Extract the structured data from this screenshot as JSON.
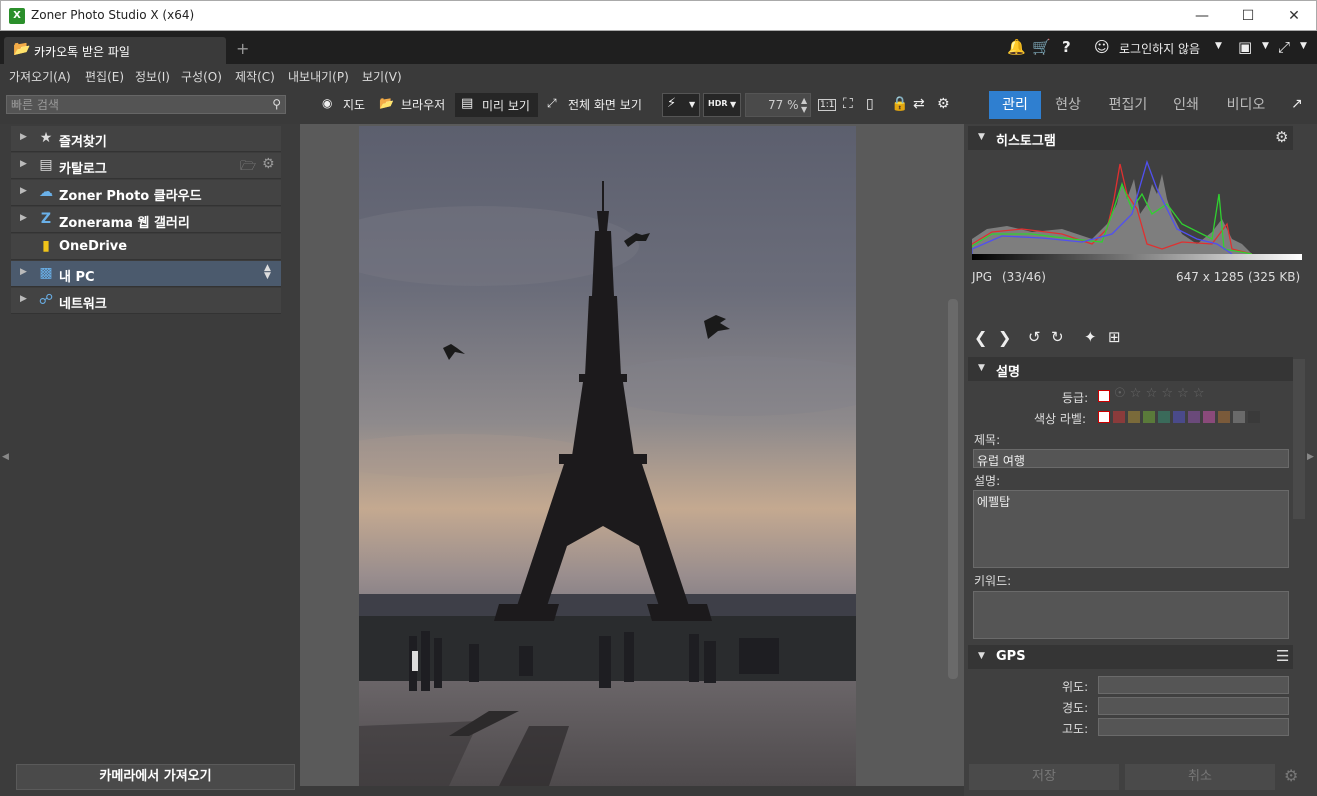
{
  "window": {
    "title": "Zoner Photo Studio X (x64)",
    "app_icon": "X"
  },
  "tabs": {
    "active_label": "카카오톡 받은 파일",
    "add": "+"
  },
  "top_right": {
    "login_label": "로그인하지 않음"
  },
  "menu": [
    "가져오기(A)",
    "편집(E)",
    "정보(I)",
    "구성(O)",
    "제작(C)",
    "내보내기(P)",
    "보기(V)"
  ],
  "search": {
    "placeholder": "빠른 검색"
  },
  "toolbar": {
    "map": "지도",
    "browser": "브라우저",
    "preview": "미리 보기",
    "fullscreen": "전체 화면 보기",
    "hdr": "HDR",
    "zoom": "77 %",
    "one_to_one": "1:1"
  },
  "modes": [
    "관리",
    "현상",
    "편집기",
    "인쇄",
    "비디오"
  ],
  "nav": [
    {
      "label": "즐겨찾기",
      "icon": "star-icon"
    },
    {
      "label": "카탈로그",
      "icon": "catalog-icon"
    },
    {
      "label": "Zoner Photo 클라우드",
      "icon": "cloud-icon"
    },
    {
      "label": "Zonerama 웹 갤러리",
      "icon": "zonerama-icon"
    },
    {
      "label": "OneDrive",
      "icon": "folder-icon"
    },
    {
      "label": "내 PC",
      "icon": "pc-icon"
    },
    {
      "label": "네트워크",
      "icon": "network-icon"
    }
  ],
  "import_button": "카메라에서 가져오기",
  "histogram": {
    "title": "히스토그램",
    "format": "JPG",
    "index": "(33/46)",
    "dimensions": "647 x 1285 (325 KB)"
  },
  "description": {
    "title": "설명",
    "rating_label": "등급:",
    "color_label_label": "색상 라벨:",
    "title_label": "제목:",
    "title_value": "유럽 여행",
    "desc_label": "설명:",
    "desc_value": "에펠탑",
    "keywords_label": "키워드:",
    "rating": 0,
    "label_colors": [
      "#8a3b3b",
      "#7a6a3a",
      "#5a7a3a",
      "#3a6a5a",
      "#4a4a8a",
      "#6a4a7a",
      "#8a4a7a",
      "#7a5a3a",
      "#6a6a6a",
      "#3a3a3a"
    ]
  },
  "gps": {
    "title": "GPS",
    "lat": "위도:",
    "lon": "경도:",
    "alt": "고도:"
  },
  "buttons": {
    "save": "저장",
    "cancel": "취소"
  },
  "colors": {
    "accent": "#2f7fd0",
    "selected_nav": "#4b5a6d"
  }
}
